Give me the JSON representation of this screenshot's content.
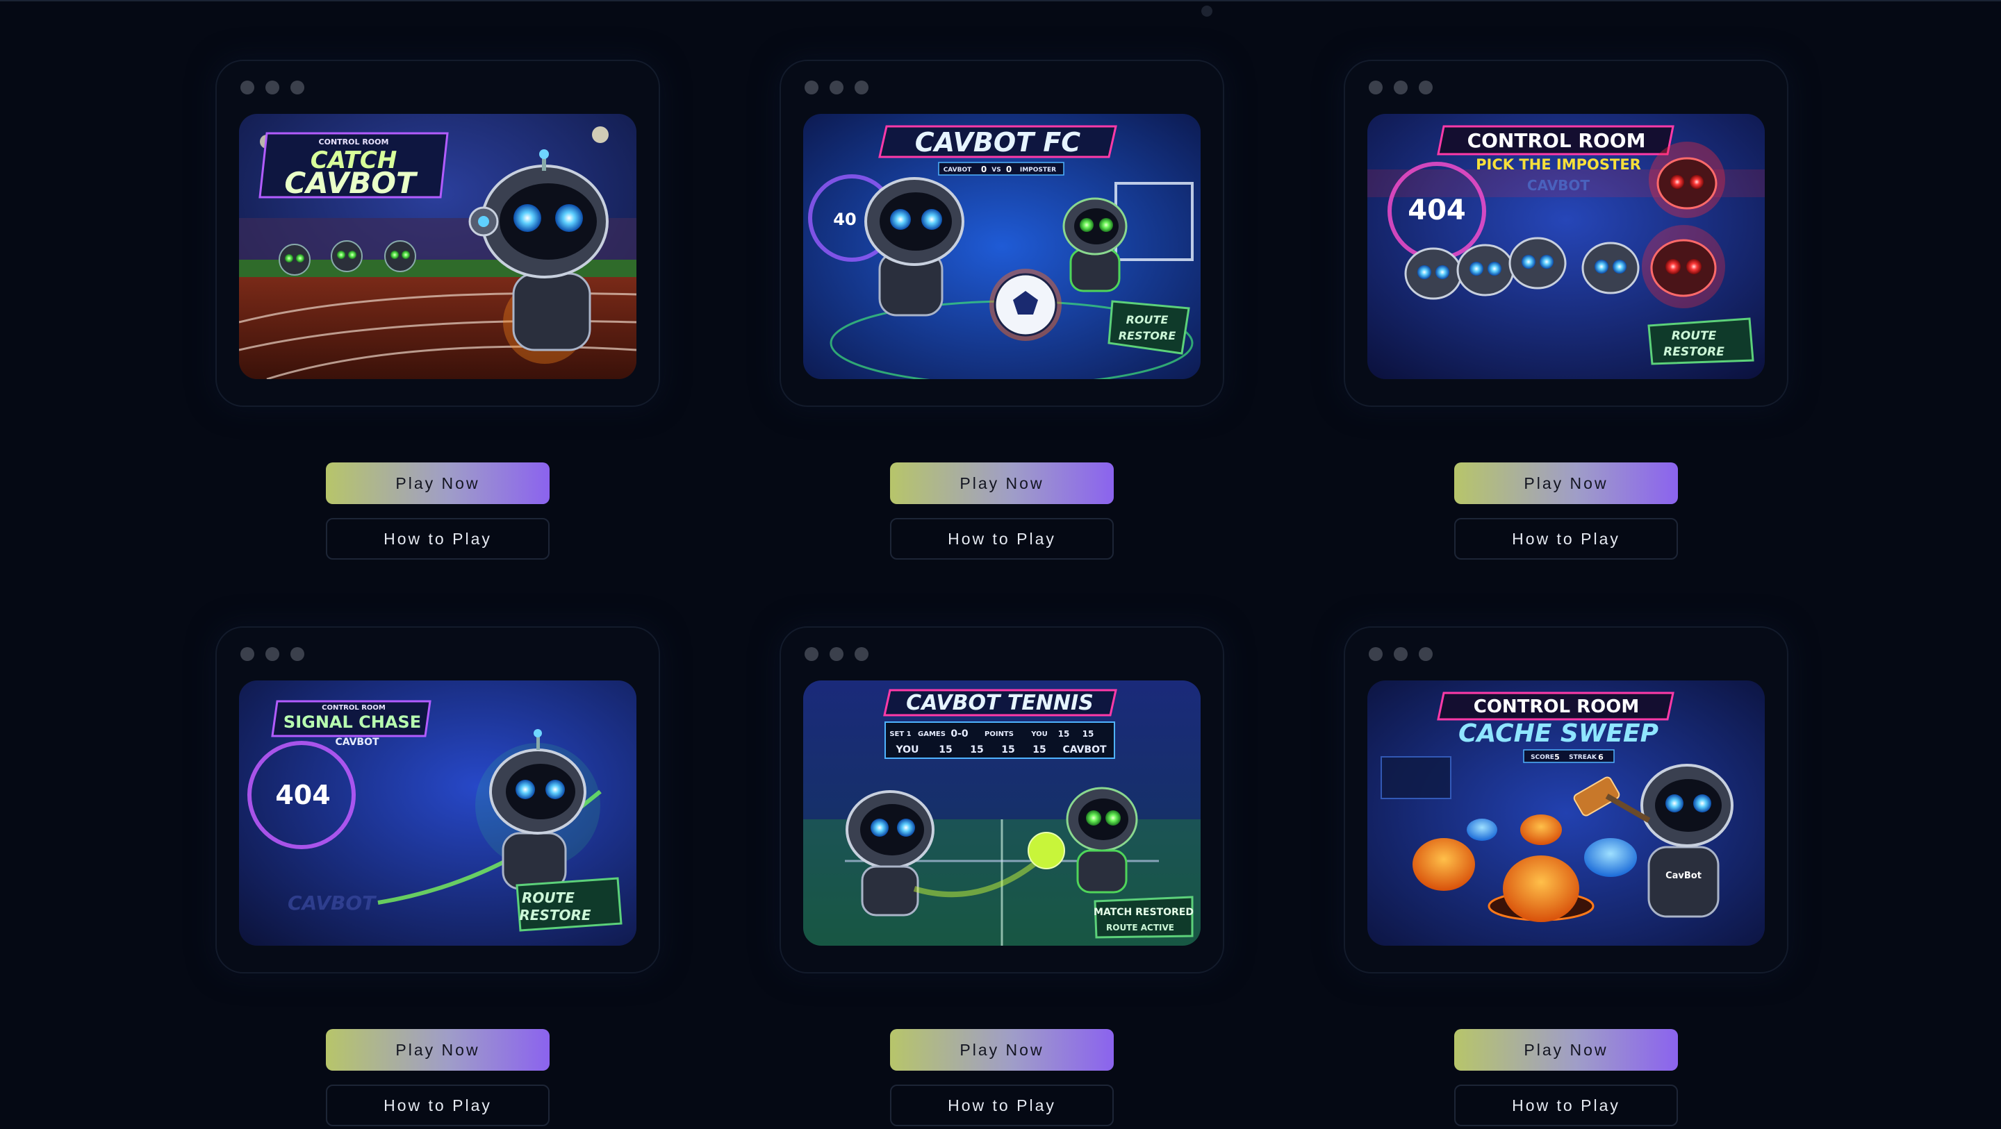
{
  "games": [
    {
      "header": "CONTROL ROOM",
      "title": "CATCH CAVBOT",
      "title_line1": "CATCH",
      "title_line2": "CAVBOT",
      "play_label": "Play Now",
      "how_label": "How to Play",
      "accent": "#7cf58c"
    },
    {
      "title": "CAVBOT FC",
      "score_left": "CAVBOT",
      "score_value_left": "0",
      "score_vs": "VS",
      "score_value_right": "0",
      "score_right": "IMPOSTER",
      "portal_text": "40",
      "sign_line1": "ROUTE",
      "sign_line2": "RESTORE",
      "play_label": "Play Now",
      "how_label": "How to Play",
      "accent": "#4fb3ff"
    },
    {
      "title": "CONTROL ROOM",
      "subtitle": "PICK THE IMPOSTER",
      "tag": "CAVBOT",
      "portal_text": "404",
      "sign_line1": "ROUTE",
      "sign_line2": "RESTORE",
      "play_label": "Play Now",
      "how_label": "How to Play",
      "accent": "#ff3b4b"
    },
    {
      "header": "CONTROL ROOM",
      "title": "SIGNAL CHASE",
      "tag": "CAVBOT",
      "portal_text": "404",
      "watermark": "CAVBOT",
      "sign_line1": "ROUTE",
      "sign_line2": "RESTORE",
      "play_label": "Play Now",
      "how_label": "How to Play",
      "accent": "#8cf58a"
    },
    {
      "title": "CAVBOT TENNIS",
      "score_row1": [
        "SET 1",
        "GAMES",
        "0-0",
        "POINTS",
        "YOU",
        "15",
        "15"
      ],
      "score_row2": [
        "YOU",
        "15",
        "15",
        "15",
        "15",
        "CAVBOT"
      ],
      "sign_line1": "MATCH RESTORED",
      "sign_line2": "ROUTE ACTIVE",
      "play_label": "Play Now",
      "how_label": "How to Play",
      "accent": "#c8f53a"
    },
    {
      "title": "CONTROL ROOM",
      "subtitle": "CACHE SWEEP",
      "score_label": "SCORE",
      "score_value": "5",
      "streak_label": "STREAK",
      "streak_value": "6",
      "chest_text": "CavBot",
      "play_label": "Play Now",
      "how_label": "How to Play",
      "accent": "#ff7a1a"
    }
  ],
  "colors": {
    "background": "#050914",
    "frame": "#060b17",
    "play_gradient_start": "#b7c56a",
    "play_gradient_end": "#8b63ee"
  }
}
